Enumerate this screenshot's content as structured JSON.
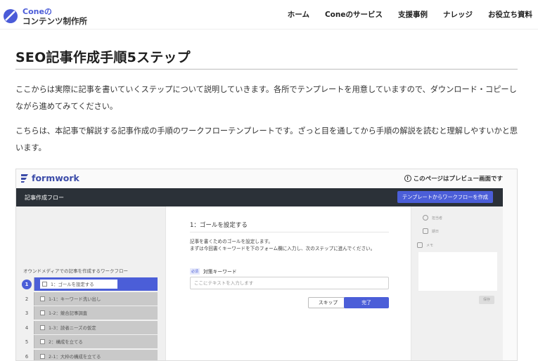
{
  "header": {
    "logo_line1": "Coneの",
    "logo_line2": "コンテンツ制作所",
    "nav": [
      "ホーム",
      "Coneのサービス",
      "支援事例",
      "ナレッジ",
      "お役立ち資料"
    ]
  },
  "article": {
    "title": "SEO記事作成手順5ステップ",
    "paragraph1": "ここからは実際に記事を書いていくステップについて説明していきます。各所でテンプレートを用意していますので、ダウンロード・コピーしながら進めてみてください。",
    "paragraph2": "こちらは、本記事で解説する記事作成の手順のワークフローテンプレートです。ざっと目を通してから手順の解説を読むと理解しやすいかと思います。"
  },
  "formwork": {
    "logo_text": "formwork",
    "preview_notice": "このページはプレビュー画面です",
    "flow_title": "記事作成フロー",
    "create_button": "テンプレートからワークフローを作成",
    "left_heading": "オウンドメディアでの記事を作成するワークフロー",
    "steps": [
      {
        "num": "1",
        "label": "1：ゴールを設定する"
      },
      {
        "num": "2",
        "label": "1-1：キーワード洗い出し"
      },
      {
        "num": "3",
        "label": "1-2：競合記事調査"
      },
      {
        "num": "4",
        "label": "1-3：読者ニーズの仮定"
      },
      {
        "num": "5",
        "label": "2：構成を立てる"
      },
      {
        "num": "6",
        "label": "2-1：大枠の構成を立てる"
      }
    ],
    "step_title": "1：ゴールを設定する",
    "step_desc_line1": "記事を書くためのゴールを設定します。",
    "step_desc_line2": "まずは今回書くキーワードを下のフォーム欄に入力し、次のステップに進んでください。",
    "required_badge": "必須",
    "keyword_label": "対策キーワード",
    "keyword_placeholder": "ここにテキストを入力します",
    "skip_button": "スキップ",
    "done_button": "完了",
    "meta_assignee": "担当者",
    "meta_due": "期日",
    "meta_memo": "メモ",
    "save_button": "保存"
  },
  "colors": {
    "accent": "#4b5ed8",
    "dark_bar": "#2b3138",
    "brand": "#3b4ba8"
  }
}
